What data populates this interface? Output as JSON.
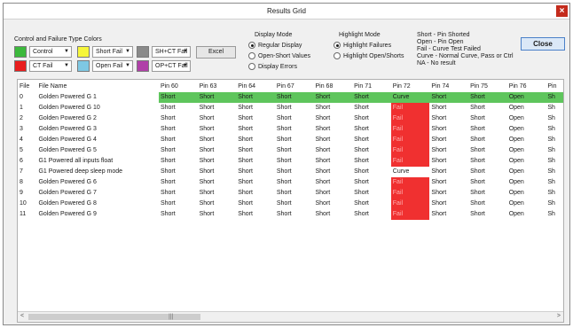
{
  "window": {
    "title": "Results Grid"
  },
  "colors_group": {
    "label": "Control and Failure Type Colors",
    "items": [
      {
        "label": "Control",
        "color": "#3cb93c"
      },
      {
        "label": "Short Fail",
        "color": "#f6f63a"
      },
      {
        "label": "SH+CT Fail",
        "color": "#8a8a8a"
      },
      {
        "label": "CT Fail",
        "color": "#e81e1e"
      },
      {
        "label": "Open Fail",
        "color": "#7ec8e3"
      },
      {
        "label": "OP+CT Fail",
        "color": "#b040a8"
      }
    ],
    "excel_label": "Excel"
  },
  "display_mode": {
    "label": "Display Mode",
    "options": [
      "Regular Display",
      "Open-Short Values",
      "Display Errors"
    ],
    "selected": 0
  },
  "highlight_mode": {
    "label": "Highlight Mode",
    "options": [
      "Highlight Failures",
      "Highlight Open/Shorts"
    ],
    "selected": 0
  },
  "legend": [
    "Short - Pin Shorted",
    "Open - Pin Open",
    "Fail - Curve Test Failed",
    "Curve - Normal Curve, Pass or Ctrl",
    "NA - No result"
  ],
  "close_label": "Close",
  "grid": {
    "columns": [
      "File",
      "File Name",
      "Pin 60",
      "Pin 63",
      "Pin 64",
      "Pin 67",
      "Pin 68",
      "Pin 71",
      "Pin 72",
      "Pin 74",
      "Pin 75",
      "Pin 76",
      "Pin"
    ],
    "rows": [
      {
        "file": "0",
        "name": "Golden Powered G 1",
        "cells": [
          "Short",
          "Short",
          "Short",
          "Short",
          "Short",
          "Short",
          "Curve",
          "Short",
          "Short",
          "Open",
          "Sh"
        ],
        "highlight": true
      },
      {
        "file": "1",
        "name": "Golden Powered G 10",
        "cells": [
          "Short",
          "Short",
          "Short",
          "Short",
          "Short",
          "Short",
          "Fail",
          "Short",
          "Short",
          "Open",
          "Sh"
        ]
      },
      {
        "file": "2",
        "name": "Golden Powered G 2",
        "cells": [
          "Short",
          "Short",
          "Short",
          "Short",
          "Short",
          "Short",
          "Fail",
          "Short",
          "Short",
          "Open",
          "Sh"
        ]
      },
      {
        "file": "3",
        "name": "Golden Powered G 3",
        "cells": [
          "Short",
          "Short",
          "Short",
          "Short",
          "Short",
          "Short",
          "Fail",
          "Short",
          "Short",
          "Open",
          "Sh"
        ]
      },
      {
        "file": "4",
        "name": "Golden Powered G 4",
        "cells": [
          "Short",
          "Short",
          "Short",
          "Short",
          "Short",
          "Short",
          "Fail",
          "Short",
          "Short",
          "Open",
          "Sh"
        ]
      },
      {
        "file": "5",
        "name": "Golden Powered G 5",
        "cells": [
          "Short",
          "Short",
          "Short",
          "Short",
          "Short",
          "Short",
          "Fail",
          "Short",
          "Short",
          "Open",
          "Sh"
        ]
      },
      {
        "file": "6",
        "name": "G1 Powered all inputs float",
        "cells": [
          "Short",
          "Short",
          "Short",
          "Short",
          "Short",
          "Short",
          "Fail",
          "Short",
          "Short",
          "Open",
          "Sh"
        ]
      },
      {
        "file": "7",
        "name": "G1 Powered deep sleep mode",
        "cells": [
          "Short",
          "Short",
          "Short",
          "Short",
          "Short",
          "Short",
          "Curve",
          "Short",
          "Short",
          "Open",
          "Sh"
        ]
      },
      {
        "file": "8",
        "name": "Golden Powered G 6",
        "cells": [
          "Short",
          "Short",
          "Short",
          "Short",
          "Short",
          "Short",
          "Fail",
          "Short",
          "Short",
          "Open",
          "Sh"
        ]
      },
      {
        "file": "9",
        "name": "Golden Powered G 7",
        "cells": [
          "Short",
          "Short",
          "Short",
          "Short",
          "Short",
          "Short",
          "Fail",
          "Short",
          "Short",
          "Open",
          "Sh"
        ]
      },
      {
        "file": "10",
        "name": "Golden Powered G 8",
        "cells": [
          "Short",
          "Short",
          "Short",
          "Short",
          "Short",
          "Short",
          "Fail",
          "Short",
          "Short",
          "Open",
          "Sh"
        ]
      },
      {
        "file": "11",
        "name": "Golden Powered G 9",
        "cells": [
          "Short",
          "Short",
          "Short",
          "Short",
          "Short",
          "Short",
          "Fail",
          "Short",
          "Short",
          "Open",
          "Sh"
        ]
      }
    ]
  }
}
